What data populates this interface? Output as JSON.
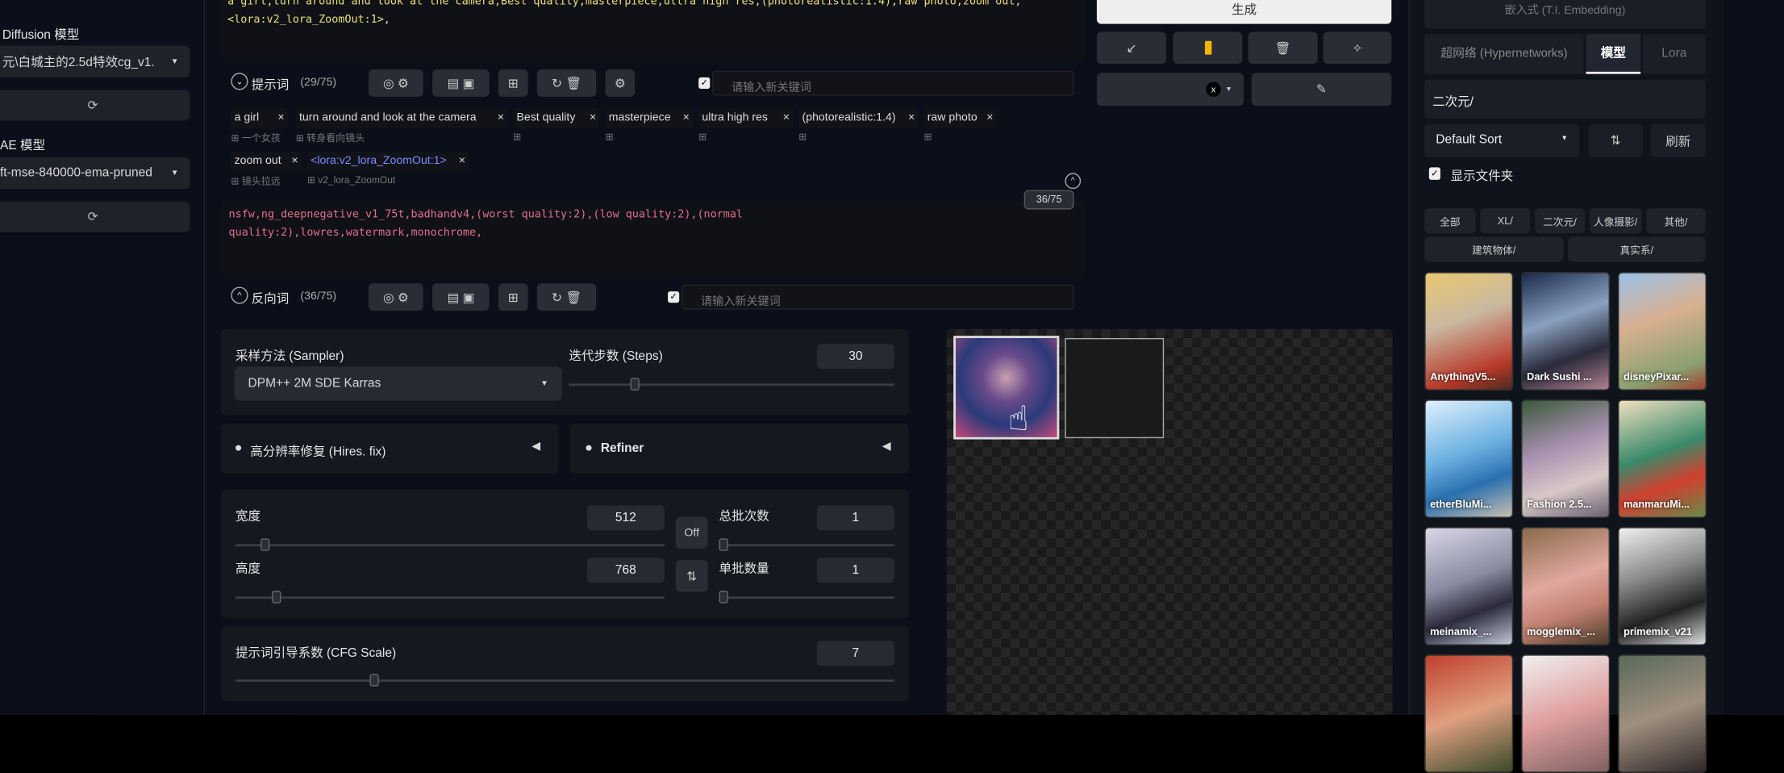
{
  "sidebar": {
    "sd_model_label": "Diffusion 模型",
    "sd_model_value": "元\\白城主的2.5d特效cg_v1.",
    "vae_label": "AE 模型",
    "vae_value": "ft-mse-840000-ema-pruned"
  },
  "prompt": {
    "text": "a girl,turn around and look at the camera,Best quality,masterpiece,ultra high res,(photorealistic:1.4),raw photo,zoom out,<lora:v2_lora_ZoomOut:1>,",
    "label": "提示词",
    "count": "(29/75)",
    "keyword_placeholder": "请输入新关键词",
    "tags": [
      {
        "text": "a girl",
        "sub": "一个女孩"
      },
      {
        "text": "turn around and look at the camera",
        "sub": "转身看向镜头"
      },
      {
        "text": "Best quality",
        "sub": ""
      },
      {
        "text": "masterpiece",
        "sub": ""
      },
      {
        "text": "ultra high res",
        "sub": ""
      },
      {
        "text": "(photorealistic:1.4)",
        "sub": ""
      },
      {
        "text": "raw photo",
        "sub": ""
      },
      {
        "text": "zoom out",
        "sub": "镜头拉远"
      },
      {
        "text": "<lora:v2_lora_ZoomOut:1>",
        "sub": "v2_lora_ZoomOut"
      }
    ]
  },
  "negative": {
    "text": "nsfw,ng_deepnegative_v1_75t,badhandv4,(worst quality:2),(low quality:2),(normal quality:2),lowres,watermark,monochrome,",
    "token_counter": "36/75",
    "label": "反向词",
    "count": "(36/75)",
    "keyword_placeholder": "请输入新关键词"
  },
  "params": {
    "sampler_label": "采样方法 (Sampler)",
    "sampler_value": "DPM++ 2M SDE Karras",
    "steps_label": "迭代步数 (Steps)",
    "steps": "30",
    "hires_label": "高分辨率修复 (Hires. fix)",
    "refiner_label": "Refiner",
    "width_label": "宽度",
    "width": "512",
    "height_label": "高度",
    "height": "768",
    "off_label": "Off",
    "batch_count_label": "总批次数",
    "batch_count": "1",
    "batch_size_label": "单批数量",
    "batch_size": "1",
    "cfg_label": "提示词引导系数 (CFG Scale)",
    "cfg": "7"
  },
  "actions": {
    "generate": "生成"
  },
  "networks": {
    "embedding_tab": "嵌入式 (T.I. Embedding)",
    "tabs": [
      "超网络 (Hypernetworks)",
      "模型",
      "Lora"
    ],
    "active_tab": "模型",
    "search_value": "二次元/",
    "sort_value": "Default Sort",
    "refresh": "刷新",
    "show_dirs": "显示文件夹",
    "filters": [
      "全部",
      "XL/",
      "二次元/",
      "人像摄影/",
      "其他/",
      "建筑物体/",
      "真实系/"
    ],
    "cards": [
      "AnythingV5...",
      "Dark Sushi ...",
      "disneyPixar...",
      "etherBluMi...",
      "Fashion 2.5...",
      "manmaruMi...",
      "meinamix_...",
      "mogglemix_...",
      "primemix_v21",
      "",
      "",
      ""
    ]
  },
  "colors": {
    "accent_yellow": "#f5b400",
    "negative_text": "#e0708a",
    "prompt_text": "#e8e07a",
    "lora_text": "#7c8cff"
  }
}
